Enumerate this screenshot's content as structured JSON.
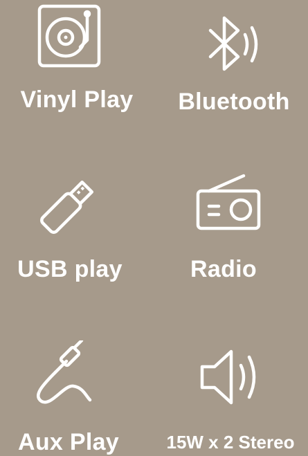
{
  "background_color": "#a69a8b",
  "text_color": "#ffffff",
  "features": [
    {
      "label": "Vinyl Play",
      "icon": "turntable-icon"
    },
    {
      "label": "Bluetooth",
      "icon": "bluetooth-icon"
    },
    {
      "label": "USB play",
      "icon": "usb-stick-icon"
    },
    {
      "label": "Radio",
      "icon": "radio-icon"
    },
    {
      "label": "Aux Play",
      "icon": "aux-cable-icon"
    },
    {
      "label": "15W x 2 Stereo",
      "icon": "speaker-icon"
    }
  ]
}
